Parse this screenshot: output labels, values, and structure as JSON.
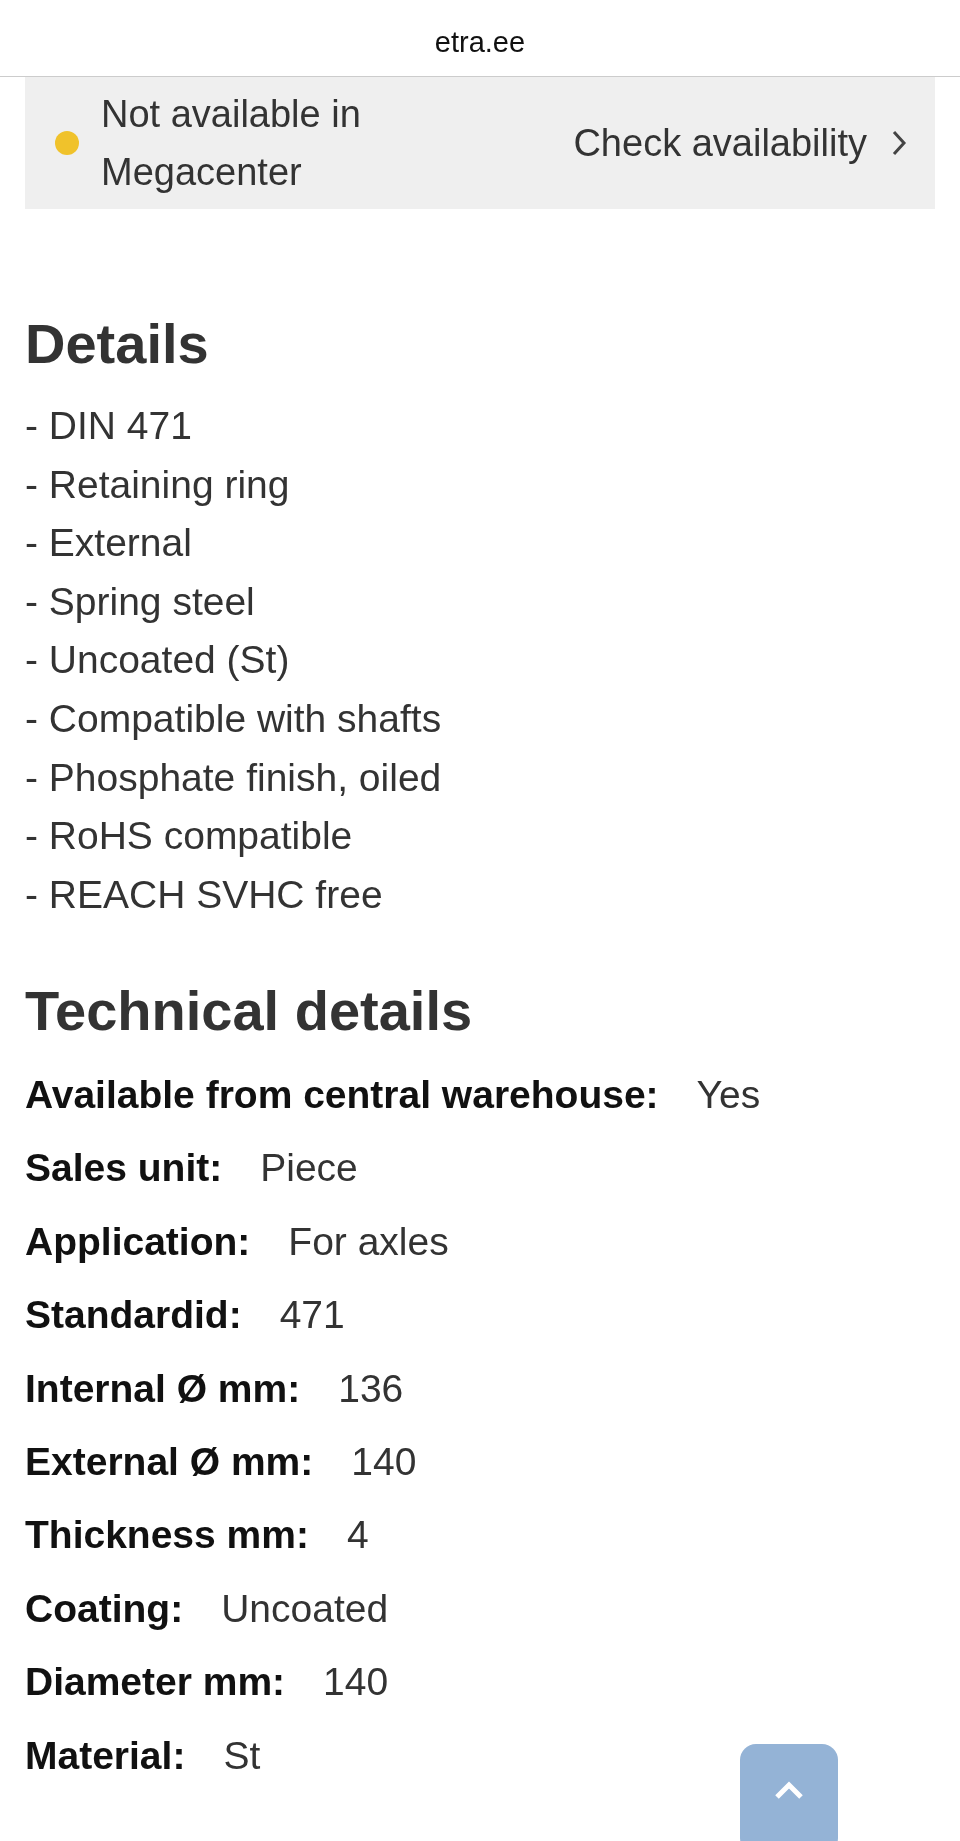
{
  "browser_bar": {
    "address": "etra.ee"
  },
  "availability": {
    "status": "Not available in Megacenter",
    "link": "Check availability"
  },
  "details": {
    "title": "Details",
    "items": [
      "- DIN 471",
      "- Retaining ring",
      "- External",
      "- Spring steel",
      "- Uncoated (St)",
      "- Compatible with shafts",
      "- Phosphate finish, oiled",
      "- RoHS compatible",
      "- REACH SVHC free"
    ]
  },
  "technical_details": {
    "title": "Technical details",
    "rows": [
      {
        "label": "Available from central warehouse:",
        "value": "Yes"
      },
      {
        "label": "Sales unit:",
        "value": "Piece"
      },
      {
        "label": "Application:",
        "value": "For axles"
      },
      {
        "label": "Standardid:",
        "value": "471"
      },
      {
        "label": "Internal Ø mm:",
        "value": "136"
      },
      {
        "label": "External Ø mm:",
        "value": "140"
      },
      {
        "label": "Thickness mm:",
        "value": "4"
      },
      {
        "label": "Coating:",
        "value": "Uncoated"
      },
      {
        "label": "Diameter mm:",
        "value": "140"
      },
      {
        "label": "Material:",
        "value": "St"
      }
    ]
  }
}
